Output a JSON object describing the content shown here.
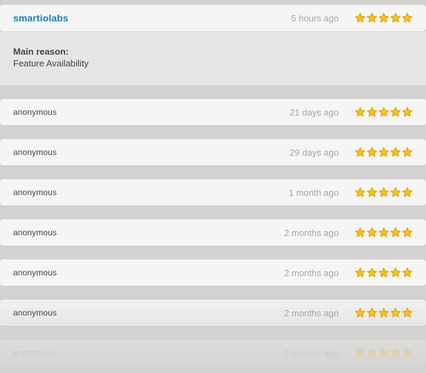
{
  "colors": {
    "background": "#d3d2d0",
    "card": "#f5f5f5",
    "username_accent": "#1a82b4",
    "time_text": "#a5a5a8",
    "star_fill": "#f7c21b",
    "star_stroke": "#d99a00"
  },
  "reviews": [
    {
      "reviewer": "smartiolabs",
      "time": "5 hours ago",
      "rating": 5,
      "max_rating": 5,
      "reason_label": "Main reason:",
      "reason_value": "Feature Availability"
    },
    {
      "reviewer": "anonymous",
      "time": "21 days ago",
      "rating": 5,
      "max_rating": 5
    },
    {
      "reviewer": "anonymous",
      "time": "29 days ago",
      "rating": 5,
      "max_rating": 5
    },
    {
      "reviewer": "anonymous",
      "time": "1 month ago",
      "rating": 5,
      "max_rating": 5
    },
    {
      "reviewer": "anonymous",
      "time": "2 months ago",
      "rating": 5,
      "max_rating": 5
    },
    {
      "reviewer": "anonymous",
      "time": "2 months ago",
      "rating": 5,
      "max_rating": 5
    },
    {
      "reviewer": "anonymous",
      "time": "2 months ago",
      "rating": 5,
      "max_rating": 5
    },
    {
      "reviewer": "anonymous",
      "time": "3 months ago",
      "rating": 5,
      "max_rating": 5
    }
  ]
}
